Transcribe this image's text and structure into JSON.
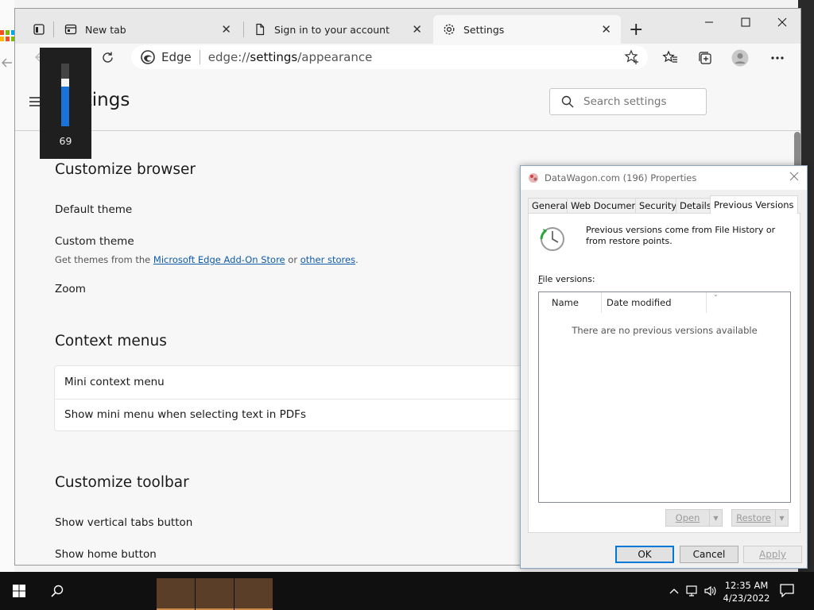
{
  "browser": {
    "tabs": [
      {
        "label": "New tab",
        "icon": "new-tab-page-icon"
      },
      {
        "label": "Sign in to your account",
        "icon": "document-icon"
      },
      {
        "label": "Settings",
        "icon": "gear-icon"
      }
    ],
    "tab_close_glyph": "✕",
    "new_tab_glyph": "+",
    "address": {
      "brand": "Edge",
      "url_prefix": "edge://",
      "url_host": "settings",
      "url_path": "/appearance"
    }
  },
  "settings": {
    "title": "Settings",
    "search_placeholder": "Search settings",
    "sections": {
      "customize_browser": {
        "title": "Customize browser",
        "default_theme": "Default theme",
        "custom_theme": "Custom theme",
        "custom_theme_sub_prefix": "Get themes from the ",
        "addon_store_link": "Microsoft Edge Add-On Store",
        "sub_or": " or ",
        "other_stores_link": "other stores",
        "sub_end": ".",
        "zoom": "Zoom"
      },
      "context_menus": {
        "title": "Context menus",
        "mini_context_menu": "Mini context menu",
        "mini_menu_pdf": "Show mini menu when selecting text in PDFs"
      },
      "customize_toolbar": {
        "title": "Customize toolbar",
        "vertical_tabs": "Show vertical tabs button",
        "home_button": "Show home button"
      }
    }
  },
  "volume_osd": {
    "value": "69",
    "level_fraction": 0.69
  },
  "properties_dialog": {
    "title": "DataWagon.com (196) Properties",
    "tabs": [
      "General",
      "Web Document",
      "Security",
      "Details",
      "Previous Versions"
    ],
    "active_tab": "Previous Versions",
    "description": "Previous versions come from File History or from restore points.",
    "file_versions_label_first": "F",
    "file_versions_label_rest": "ile versions:",
    "columns": [
      "Name",
      "Date modified"
    ],
    "empty_message": "There are no previous versions available",
    "open_button": "Open",
    "restore_button": "Restore",
    "ok_button": "OK",
    "cancel_button": "Cancel",
    "apply_button": "Apply"
  },
  "taskbar": {
    "time": "12:35 AM",
    "date": "4/23/2022"
  },
  "colors": {
    "accent": "#0078d7",
    "link": "#0f5ca8",
    "volume_fill": "#1a73d9",
    "taskbar_app": "#5a3e28"
  }
}
